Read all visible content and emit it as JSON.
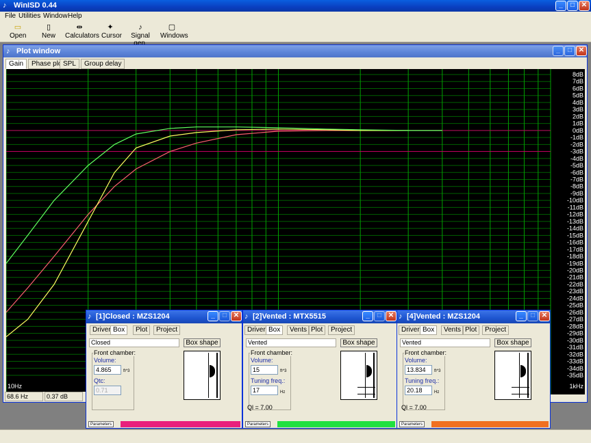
{
  "app": {
    "title": "WinISD 0.44"
  },
  "menu": [
    "File",
    "Utilities",
    "Window",
    "Help"
  ],
  "toolbar": [
    {
      "label": "Open",
      "icon": "folder-icon"
    },
    {
      "label": "New",
      "icon": "new-doc-icon"
    },
    {
      "label": "Calculators",
      "icon": "calculator-icon"
    },
    {
      "label": "Cursor",
      "icon": "cursor-icon"
    },
    {
      "label": "Signal gen.",
      "icon": "signal-gen-icon"
    },
    {
      "label": "Windows",
      "icon": "windows-icon"
    }
  ],
  "plot_window": {
    "title": "Plot window",
    "tabs": [
      "Gain",
      "Phase plot",
      "SPL",
      "Group delay"
    ],
    "x_start": "10Hz",
    "x_end": "1kHz",
    "status": {
      "freq": "68.6 Hz",
      "gain": "0.37 dB"
    }
  },
  "chart_data": {
    "type": "line",
    "ylabels": [
      "8dB",
      "7dB",
      "6dB",
      "5dB",
      "4dB",
      "3dB",
      "2dB",
      "1dB",
      "0dB",
      "-1dB",
      "-2dB",
      "-3dB",
      "-4dB",
      "-5dB",
      "-6dB",
      "-7dB",
      "-8dB",
      "-9dB",
      "-10dB",
      "-11dB",
      "-12dB",
      "-13dB",
      "-14dB",
      "-15dB",
      "-16dB",
      "-17dB",
      "-18dB",
      "-19dB",
      "-20dB",
      "-21dB",
      "-22dB",
      "-23dB",
      "-24dB",
      "-25dB",
      "-26dB",
      "-27dB",
      "-28dB",
      "-29dB",
      "-30dB",
      "-31dB",
      "-32dB",
      "-33dB",
      "-34dB",
      "-35dB"
    ],
    "ylim": [
      -35,
      8
    ],
    "xlim": [
      10,
      1000
    ],
    "x_log": true,
    "grid": true,
    "series": [
      {
        "color": "#ff6070",
        "x": [
          10,
          12,
          15,
          20,
          25,
          30,
          40,
          50,
          70,
          100,
          150,
          200,
          300,
          400
        ],
        "y": [
          -26,
          -22.5,
          -18,
          -12,
          -8,
          -5.5,
          -3,
          -1.8,
          -0.6,
          -0.1,
          0,
          0,
          0,
          0
        ]
      },
      {
        "color": "#ffff60",
        "x": [
          10,
          12,
          15,
          20,
          25,
          30,
          40,
          50,
          70,
          100,
          150,
          200,
          300
        ],
        "y": [
          -29.5,
          -27,
          -22,
          -13,
          -6,
          -2.5,
          -0.8,
          -0.3,
          0.1,
          0.2,
          0.1,
          0,
          0
        ]
      },
      {
        "color": "#60ff60",
        "x": [
          10,
          12,
          15,
          20,
          25,
          30,
          40,
          50,
          70,
          100,
          150,
          200,
          300,
          400
        ],
        "y": [
          -19,
          -15,
          -10,
          -5,
          -2,
          -0.5,
          0.3,
          0.5,
          0.5,
          0.4,
          0.2,
          0.1,
          0,
          0
        ]
      }
    ],
    "markers": [
      {
        "color": "#c00060",
        "y": 0
      },
      {
        "color": "#c00060",
        "y": -3
      }
    ]
  },
  "box_windows": [
    {
      "title": "[1]Closed : MZS1204",
      "tabs": [
        "Driver",
        "Box",
        "Plot",
        "Project"
      ],
      "box_type": "Closed",
      "box_shape_label": "Box shape",
      "group_label": "Front chamber:",
      "volume_label": "Volume:",
      "volume": "4.865",
      "volume_unit": "ft^3",
      "second_label": "Qtc:",
      "second_value": "0.71",
      "second_unit": "",
      "ql": "",
      "params_label": "Parameters",
      "color": "#e8207c"
    },
    {
      "title": "[2]Vented : MTX5515",
      "tabs": [
        "Driver",
        "Box",
        "Vents",
        "Plot",
        "Project"
      ],
      "box_type": "Vented",
      "box_shape_label": "Box shape",
      "group_label": "Front chamber:",
      "volume_label": "Volume:",
      "volume": "15",
      "volume_unit": "ft^3",
      "second_label": "Tuning freq.:",
      "second_value": "17",
      "second_unit": "Hz",
      "ql": "Ql = 7.00",
      "params_label": "Parameters",
      "color": "#20e040"
    },
    {
      "title": "[4]Vented : MZS1204",
      "tabs": [
        "Driver",
        "Box",
        "Vents",
        "Plot",
        "Project"
      ],
      "box_type": "Vented",
      "box_shape_label": "Box shape",
      "group_label": "Front chamber:",
      "volume_label": "Volume:",
      "volume": "13.834",
      "volume_unit": "ft^3",
      "second_label": "Tuning freq.:",
      "second_value": "20.18",
      "second_unit": "Hz",
      "ql": "Ql = 7.00",
      "params_label": "Parameters",
      "color": "#f07020"
    }
  ]
}
